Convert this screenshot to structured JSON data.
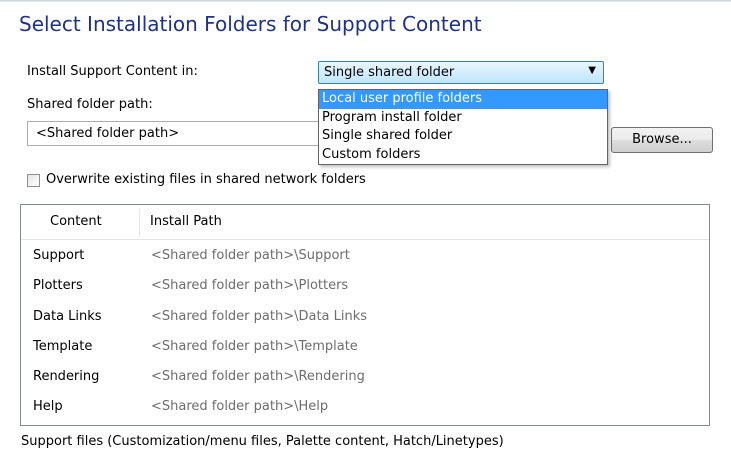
{
  "page": {
    "title": "Select Installation Folders for Support Content"
  },
  "install_in": {
    "label": "Install Support Content in:",
    "selected": "Single shared folder",
    "options": [
      "Local user profile folders",
      "Program install folder",
      "Single shared folder",
      "Custom folders"
    ],
    "highlighted_option": "Local user profile folders"
  },
  "shared_folder": {
    "label": "Shared folder path:",
    "value": "<Shared folder path>",
    "browse_label": "Browse..."
  },
  "overwrite": {
    "label": "Overwrite existing files in shared network folders",
    "checked": false
  },
  "table": {
    "headers": [
      "Content",
      "Install Path"
    ],
    "rows": [
      {
        "content": "Support",
        "path": "<Shared folder path>\\Support"
      },
      {
        "content": "Plotters",
        "path": "<Shared folder path>\\Plotters"
      },
      {
        "content": "Data Links",
        "path": "<Shared folder path>\\Data Links"
      },
      {
        "content": "Template",
        "path": "<Shared folder path>\\Template"
      },
      {
        "content": "Rendering",
        "path": "<Shared folder path>\\Rendering"
      },
      {
        "content": "Help",
        "path": "<Shared folder path>\\Help"
      }
    ]
  },
  "footer": {
    "description": "Support files (Customization/menu files, Palette content, Hatch/Linetypes)"
  },
  "colors": {
    "title": "#1e3287",
    "selection": "#3399ff",
    "path_text": "#6d6d6d"
  },
  "icons": {
    "dropdown_arrow": "chevron-down-icon"
  }
}
